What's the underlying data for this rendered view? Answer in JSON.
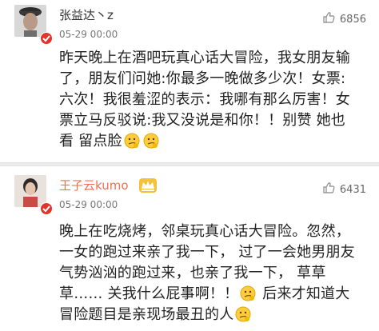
{
  "comments": [
    {
      "username": "张益达丶z",
      "time": "05-29 00:00",
      "likes": "6856",
      "lines": [
        "昨天晚上在酒吧玩真心话大冒险，我女朋友输",
        "了，朋友们问她:你最多一晚做多少次！女票:",
        "六次！我很羞涩的表示：我哪有那么厉害！女",
        "票立马反驳说:我又没说是和你！！别赞 她也",
        "看 留点脸"
      ]
    },
    {
      "username": "王子云kumo",
      "time": "05-29 00:00",
      "likes": "6431",
      "lines": [
        "晚上在吃烧烤，邻桌玩真心话大冒险。忽然，",
        "一女的跑过来亲了我一下， 过了一会她男朋友",
        "气势汹汹的跑过来，也亲了我一下， 草草",
        "草…… 关我什么屁事啊！！",
        "后来才知道大",
        "冒险题目是亲现场最丑的人"
      ]
    }
  ],
  "icons": {
    "like": "thumbs-up-icon",
    "verified": "verified-badge-icon",
    "emoji": "thinking-face-emoji-icon",
    "crown": "member-crown-icon"
  },
  "colors": {
    "vip_username": "#eb7350",
    "verified_badge": "#e0342c",
    "separator": "#ececec"
  }
}
